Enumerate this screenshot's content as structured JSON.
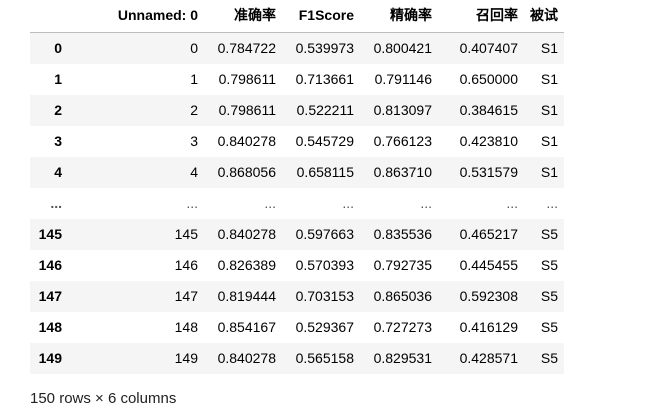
{
  "table": {
    "columns": [
      "",
      "Unnamed: 0",
      "准确率",
      "F1Score",
      "精确率",
      "召回率",
      "被试"
    ],
    "rows": [
      {
        "index": "0",
        "cells": [
          "0",
          "0.784722",
          "0.539973",
          "0.800421",
          "0.407407",
          "S1"
        ]
      },
      {
        "index": "1",
        "cells": [
          "1",
          "0.798611",
          "0.713661",
          "0.791146",
          "0.650000",
          "S1"
        ]
      },
      {
        "index": "2",
        "cells": [
          "2",
          "0.798611",
          "0.522211",
          "0.813097",
          "0.384615",
          "S1"
        ]
      },
      {
        "index": "3",
        "cells": [
          "3",
          "0.840278",
          "0.545729",
          "0.766123",
          "0.423810",
          "S1"
        ]
      },
      {
        "index": "4",
        "cells": [
          "4",
          "0.868056",
          "0.658115",
          "0.863710",
          "0.531579",
          "S1"
        ]
      },
      {
        "index": "...",
        "cells": [
          "...",
          "...",
          "...",
          "...",
          "...",
          "..."
        ]
      },
      {
        "index": "145",
        "cells": [
          "145",
          "0.840278",
          "0.597663",
          "0.835536",
          "0.465217",
          "S5"
        ]
      },
      {
        "index": "146",
        "cells": [
          "146",
          "0.826389",
          "0.570393",
          "0.792735",
          "0.445455",
          "S5"
        ]
      },
      {
        "index": "147",
        "cells": [
          "147",
          "0.819444",
          "0.703153",
          "0.865036",
          "0.592308",
          "S5"
        ]
      },
      {
        "index": "148",
        "cells": [
          "148",
          "0.854167",
          "0.529367",
          "0.727273",
          "0.416129",
          "S5"
        ]
      },
      {
        "index": "149",
        "cells": [
          "149",
          "0.840278",
          "0.565158",
          "0.829531",
          "0.428571",
          "S5"
        ]
      }
    ]
  },
  "footer": {
    "shape_text": "150 rows × 6 columns"
  },
  "colors": {
    "row_stripe": "#f5f5f5",
    "header_border": "#bdbdbd"
  }
}
